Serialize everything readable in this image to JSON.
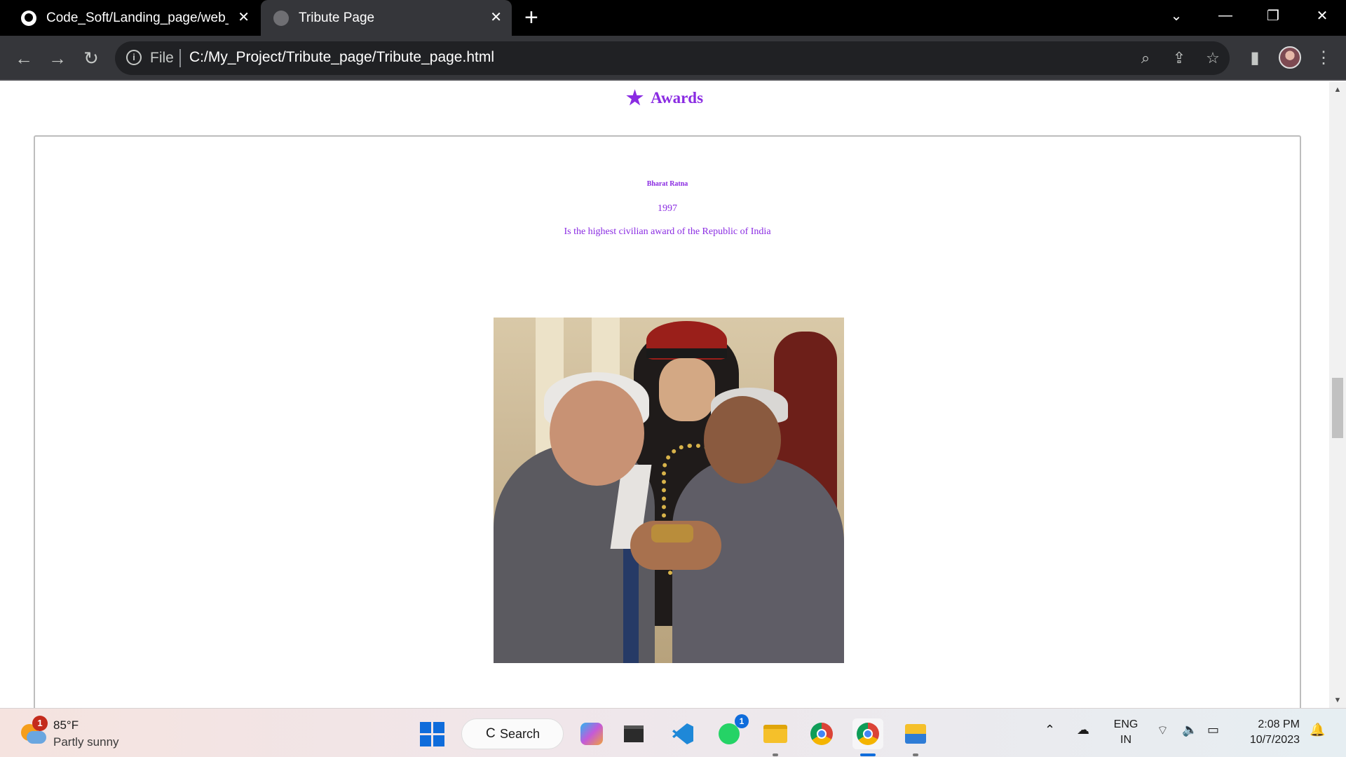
{
  "browser": {
    "tabs": [
      {
        "title": "Code_Soft/Landing_page/web_",
        "favicon": "github-icon",
        "active": false
      },
      {
        "title": "Tribute Page",
        "favicon": "globe-icon",
        "active": true
      }
    ],
    "address": {
      "scheme_label": "File",
      "url": "C:/My_Project/Tribute_page/Tribute_page.html"
    }
  },
  "page": {
    "section_title": "Awards",
    "section_icon": "star-icon",
    "award": {
      "name": "Bharat Ratna",
      "year": "1997",
      "description": "Is the highest civilian award of the Republic of India"
    },
    "colors": {
      "accent": "#8a2be2"
    }
  },
  "taskbar": {
    "weather": {
      "temperature": "85°F",
      "condition": "Partly sunny",
      "badge": "1"
    },
    "search_label": "Search",
    "whatsapp_badge": "1",
    "language": {
      "line1": "ENG",
      "line2": "IN"
    },
    "clock": {
      "time": "2:08 PM",
      "date": "10/7/2023"
    }
  }
}
